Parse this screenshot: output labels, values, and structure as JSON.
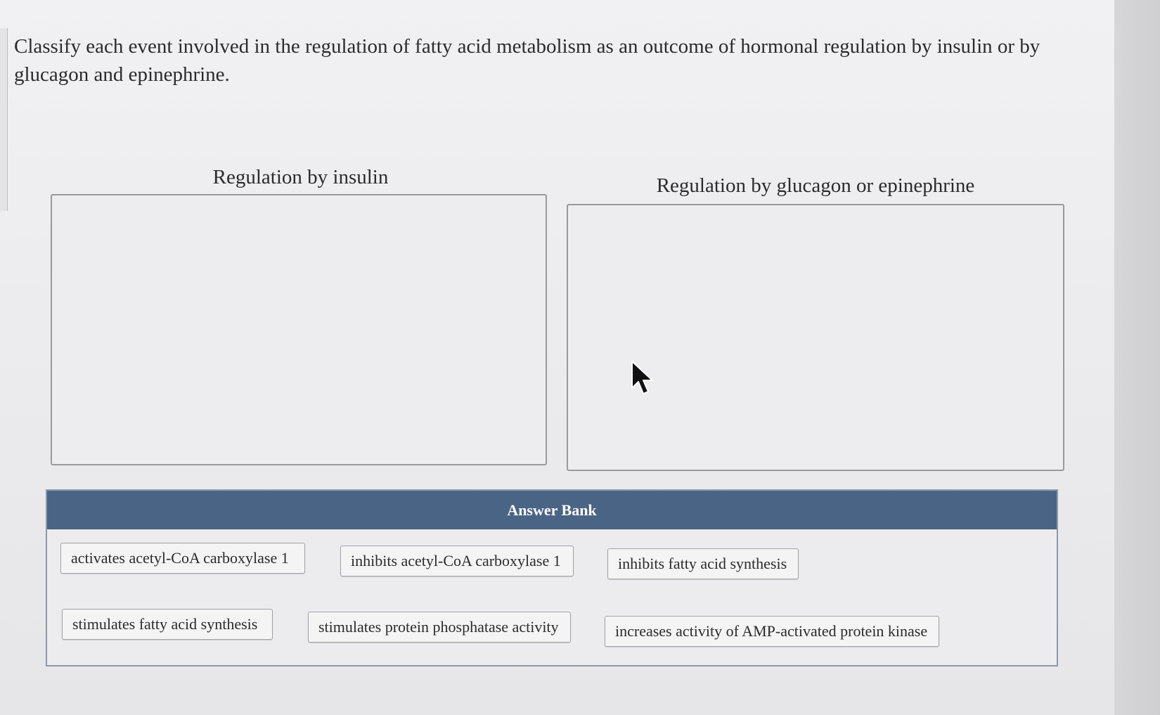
{
  "question": {
    "text": "Classify each event involved in the regulation of fatty acid metabolism as an outcome of hormonal regulation by insulin or by glucagon and epinephrine."
  },
  "zones": {
    "insulin_title": "Regulation by insulin",
    "glucagon_title": "Regulation by glucagon or epinephrine"
  },
  "answer_bank": {
    "title": "Answer Bank",
    "items": [
      "activates acetyl-CoA carboxylase 1",
      "inhibits acetyl-CoA carboxylase 1",
      "inhibits fatty acid synthesis",
      "stimulates fatty acid synthesis",
      "stimulates protein phosphatase activity",
      "increases activity of AMP-activated protein kinase"
    ]
  },
  "colors": {
    "bank_header": "#4a6485",
    "background": "#ececee"
  },
  "icons": {
    "pointer": "mouse-cursor-icon"
  }
}
